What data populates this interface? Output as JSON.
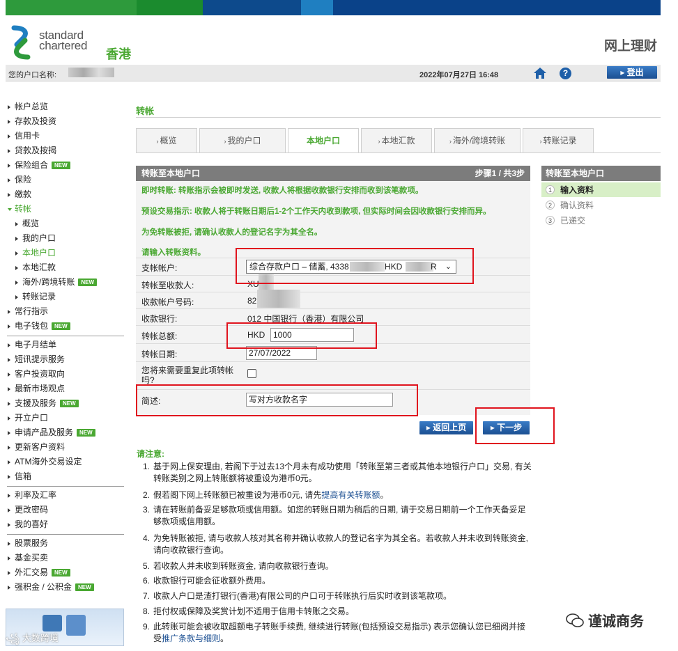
{
  "colors": {
    "brand_green": "#4aa832",
    "brand_blue": "#1b4f92",
    "highlight_red": "#e0141e"
  },
  "header": {
    "brand_line1": "standard",
    "brand_line2": "chartered",
    "region": "香港",
    "product": "网上理财"
  },
  "account_bar": {
    "account_name_label": "您的户口名称:",
    "datetime": "2022年07月27日 16:48",
    "logout_label": "登出"
  },
  "left_nav": {
    "items": [
      {
        "label": "帐户总览"
      },
      {
        "label": "存款及投资"
      },
      {
        "label": "信用卡"
      },
      {
        "label": "贷款及按揭"
      },
      {
        "label": "保险组合",
        "badge": "NEW"
      },
      {
        "label": "保险"
      },
      {
        "label": "缴款"
      },
      {
        "label": "转帐"
      },
      {
        "label": "概览"
      },
      {
        "label": "我的户口"
      },
      {
        "label": "本地户口"
      },
      {
        "label": "本地汇款"
      },
      {
        "label": "海外/跨境转账",
        "badge": "NEW"
      },
      {
        "label": "转账记录"
      },
      {
        "label": "常行指示"
      },
      {
        "label": "电子钱包",
        "badge": "NEW"
      },
      {
        "label": "电子月结单"
      },
      {
        "label": "短讯提示服务"
      },
      {
        "label": "客户投资取向"
      },
      {
        "label": "最新市场观点"
      },
      {
        "label": "支援及服务",
        "badge": "NEW"
      },
      {
        "label": "开立户口"
      },
      {
        "label": "申请产品及服务",
        "badge": "NEW"
      },
      {
        "label": "更新客户资料"
      },
      {
        "label": "ATM海外交易设定"
      },
      {
        "label": "信箱"
      },
      {
        "label": "利率及汇率"
      },
      {
        "label": "更改密码"
      },
      {
        "label": "我的喜好"
      },
      {
        "label": "股票服务"
      },
      {
        "label": "基金买卖"
      },
      {
        "label": "外汇交易",
        "badge": "NEW"
      },
      {
        "label": "强积金 / 公积金",
        "badge": "NEW"
      }
    ],
    "footer_watermark": "大数跨境"
  },
  "main": {
    "page_title": "转帐",
    "tabs": [
      {
        "label": "概览"
      },
      {
        "label": "我的户口"
      },
      {
        "label": "本地户口"
      },
      {
        "label": "本地汇款"
      },
      {
        "label": "海外/跨境转账"
      },
      {
        "label": "转账记录"
      }
    ],
    "form": {
      "title": "转账至本地户口",
      "step_text": "步骤1 / 共3步",
      "notes": [
        "即时转账: 转账指示会被即时发送, 收款人将根据收款银行安排而收到该笔款项。",
        "预设交易指示: 收款人将于转账日期后1-2个工作天内收到款项, 但实际时间会因收款银行安排而异。",
        "为免转账被拒, 请确认收款人的登记名字为其全名。"
      ],
      "prompt": "请输入转账资料。",
      "from_label": "支帐帐户:",
      "from_value": "综合存款户口 – 储蓄, 4338",
      "from_currency": "HKD",
      "from_suffix": "R",
      "payee_label": "转帐至收款人:",
      "payee_value": "XU",
      "account_no_label": "收款帐户号码:",
      "account_no_value": "82",
      "bank_label": "收款银行:",
      "bank_value": "012 中国银行（香港）有限公司",
      "amount_label": "转帐总额:",
      "amount_currency": "HKD",
      "amount_value": "1000",
      "date_label": "转帐日期:",
      "date_value": "27/07/2022",
      "repeat_label": "您将来需要重复此项转帐吗?",
      "memo_label": "简述:",
      "memo_value": "写对方收款名字",
      "back_button": "返回上页",
      "next_button": "下一步"
    },
    "steps_panel": {
      "title": "转账至本地户口",
      "steps": [
        {
          "num": "1",
          "label": "输入资料"
        },
        {
          "num": "2",
          "label": "确认资料"
        },
        {
          "num": "3",
          "label": "已递交"
        }
      ]
    },
    "notes_title": "请注意:",
    "notes": [
      {
        "num": "1.",
        "text": "基于网上保安理由, 若阁下于过去13个月未有成功使用「转账至第三者或其他本地银行户口」交易, 有关转账类别之网上转账额将被重设为港币0元。"
      },
      {
        "num": "2.",
        "text": "假若阁下网上转账额已被重设为港币0元, 请先",
        "link": "提高有关转账额",
        "after": "。"
      },
      {
        "num": "3.",
        "text": "请在转账前备妥足够款项或信用额。如您的转账日期为稍后的日期, 请于交易日期前一个工作天备妥足够款项或信用额。"
      },
      {
        "num": "4.",
        "text": "为免转账被拒, 请与收款人核对其名称并确认收款人的登记名字为其全名。若收款人并未收到转账资金, 请向收款银行查询。"
      },
      {
        "num": "5.",
        "text": "若收款人并未收到转账资金, 请向收款银行查询。"
      },
      {
        "num": "6.",
        "text": "收款银行可能会征收额外费用。"
      },
      {
        "num": "7.",
        "text": "收款人户口是渣打银行(香港)有限公司的户口可于转账执行后实时收到该笔款项。"
      },
      {
        "num": "8.",
        "text": "拒付权或保障及奖赏计划不适用于信用卡转账之交易。"
      },
      {
        "num": "9.",
        "text": "此转账可能会被收取超额电子转账手续费, 继续进行转账(包括预设交易指示) 表示您确认您已细阅并接受",
        "link": "推广条款与细则",
        "after": "。"
      }
    ]
  },
  "watermark": "谨诚商务"
}
